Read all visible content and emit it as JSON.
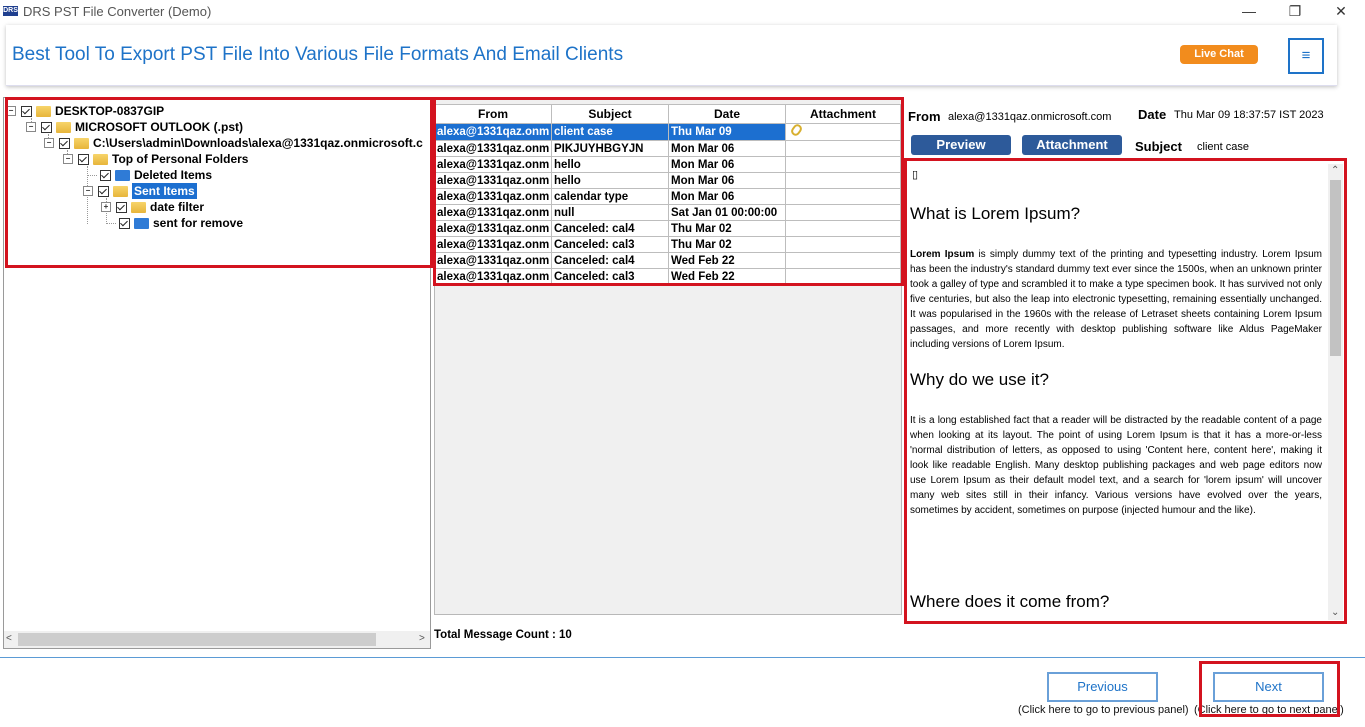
{
  "window": {
    "icon_text": "DRS",
    "title": "DRS PST File Converter (Demo)",
    "controls": {
      "minimize": "—",
      "maximize": "❐",
      "close": "✕"
    }
  },
  "banner": {
    "title": "Best Tool To Export PST File Into Various File Formats And Email Clients",
    "live_chat": "Live Chat",
    "menu_icon": "≡"
  },
  "tree": {
    "items": [
      {
        "label": "DESKTOP-0837GIP",
        "icon": "folder-icon"
      },
      {
        "label": "MICROSOFT OUTLOOK (.pst)",
        "icon": "folder-icon"
      },
      {
        "label": "C:\\Users\\admin\\Downloads\\alexa@1331qaz.onmicrosoft.c",
        "icon": "folder-icon"
      },
      {
        "label": "Top of Personal Folders",
        "icon": "folder-icon"
      },
      {
        "label": "Deleted Items",
        "icon": "blue-folder-icon"
      },
      {
        "label": "Sent Items",
        "icon": "folder-icon",
        "selected": true
      },
      {
        "label": "date filter",
        "icon": "folder-icon"
      },
      {
        "label": "sent for remove",
        "icon": "blue-folder-icon"
      }
    ]
  },
  "grid": {
    "columns": [
      "From",
      "Subject",
      "Date",
      "Attachment"
    ],
    "rows": [
      {
        "from": "alexa@1331qaz.onm",
        "subject": "client case",
        "date": "Thu Mar 09",
        "attachment": true
      },
      {
        "from": "alexa@1331qaz.onm",
        "subject": "PIKJUYHBGYJN",
        "date": "Mon Mar 06"
      },
      {
        "from": "alexa@1331qaz.onm",
        "subject": "hello",
        "date": "Mon Mar 06"
      },
      {
        "from": "alexa@1331qaz.onm",
        "subject": "hello",
        "date": "Mon Mar 06"
      },
      {
        "from": "alexa@1331qaz.onm",
        "subject": "calendar type",
        "date": "Mon Mar 06"
      },
      {
        "from": "alexa@1331qaz.onm",
        "subject": "null",
        "date": "Sat Jan 01 00:00:00"
      },
      {
        "from": "alexa@1331qaz.onm",
        "subject": "Canceled: cal4",
        "date": "Thu Mar 02"
      },
      {
        "from": "alexa@1331qaz.onm",
        "subject": "Canceled: cal3",
        "date": "Thu Mar 02"
      },
      {
        "from": "alexa@1331qaz.onm",
        "subject": "Canceled: cal4",
        "date": "Wed Feb 22"
      },
      {
        "from": "alexa@1331qaz.onm",
        "subject": "Canceled: cal3",
        "date": "Wed Feb 22"
      }
    ],
    "total": "Total Message Count : 10"
  },
  "preview": {
    "from_label": "From",
    "from_value": "alexa@1331qaz.onmicrosoft.com",
    "date_label": "Date",
    "date_value": "Thu Mar 09 18:37:57 IST 2023",
    "preview_tab": "Preview",
    "attachment_tab": "Attachment",
    "subject_label": "Subject",
    "subject_value": "client case",
    "glyph": "▯",
    "h1": "What is Lorem Ipsum?",
    "p1_bold": "Lorem Ipsum",
    "p1": " is simply dummy text of the printing and typesetting industry. Lorem Ipsum has been the industry's standard dummy text ever since the 1500s, when an unknown printer took a galley of type and scrambled it to make a type specimen book. It has survived not only five centuries, but also the leap into electronic typesetting, remaining essentially unchanged. It was popularised in the 1960s with the release of Letraset sheets containing Lorem Ipsum passages, and more recently with desktop publishing software like Aldus PageMaker including versions of Lorem Ipsum.",
    "h2": "Why do we use it?",
    "p2": "It is a long established fact that a reader will be distracted by the readable content of a page when looking at its layout. The point of using Lorem Ipsum is that it has a more-or-less 'normal distribution of letters, as opposed to using 'Content here, content here', making it look like readable English. Many desktop publishing packages and web page editors now use Lorem Ipsum as their default model text, and a search for 'lorem ipsum' will uncover many web sites still in their infancy. Various versions have evolved over the years, sometimes by accident, sometimes on purpose (injected humour and the like).",
    "h3": "Where does it come from?"
  },
  "nav": {
    "previous": "Previous",
    "previous_hint": "(Click here to go to previous panel)",
    "next": "Next",
    "next_hint": "(Click here to go to next panel)"
  }
}
